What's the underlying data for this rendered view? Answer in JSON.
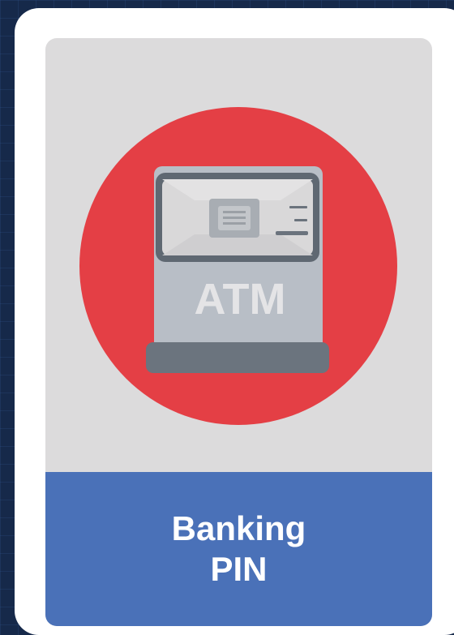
{
  "card": {
    "label_line1": "Banking",
    "label_line2": "PIN"
  },
  "illustration": {
    "icon": "atm-icon",
    "atm_text": "ATM"
  },
  "colors": {
    "background": "#16294a",
    "card": "#ffffff",
    "panel": "#dcdbdc",
    "circle": "#e43f45",
    "atm_body": "#b8bec6",
    "atm_screen_frame": "#5f6872",
    "atm_base": "#6b747e",
    "label_band": "#4a71b8"
  }
}
